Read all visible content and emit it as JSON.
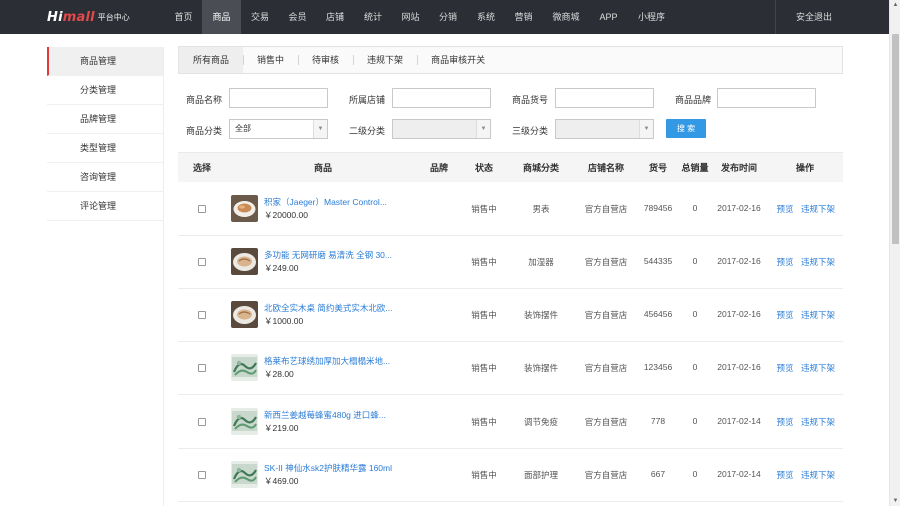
{
  "logo": {
    "brand_part1": "Hi",
    "brand_part2": "mall",
    "subtitle": "平台中心"
  },
  "nav": [
    "首页",
    "商品",
    "交易",
    "会员",
    "店铺",
    "统计",
    "网站",
    "分销",
    "系统",
    "营销",
    "微商城",
    "APP",
    "小程序"
  ],
  "nav_active": "商品",
  "logout": "安全退出",
  "sidebar": [
    {
      "label": "商品管理",
      "active": true
    },
    {
      "label": "分类管理",
      "active": false
    },
    {
      "label": "品牌管理",
      "active": false
    },
    {
      "label": "类型管理",
      "active": false
    },
    {
      "label": "咨询管理",
      "active": false
    },
    {
      "label": "评论管理",
      "active": false
    }
  ],
  "tabs": [
    {
      "label": "所有商品",
      "active": true
    },
    {
      "label": "销售中",
      "active": false
    },
    {
      "label": "待审核",
      "active": false
    },
    {
      "label": "违规下架",
      "active": false
    },
    {
      "label": "商品审核开关",
      "active": false
    }
  ],
  "filters": {
    "product_name_label": "商品名称",
    "store_label": "所属店铺",
    "sku_label": "商品货号",
    "brand_label": "商品品牌",
    "category_label": "商品分类",
    "category_value": "全部",
    "cat2_label": "二级分类",
    "cat3_label": "三级分类",
    "search_button": "搜 索"
  },
  "table": {
    "headers": [
      "选择",
      "商品",
      "品牌",
      "状态",
      "商城分类",
      "店铺名称",
      "货号",
      "总销量",
      "发布时间",
      "操作"
    ],
    "rows": [
      {
        "name": "积家（Jaeger）Master Control...",
        "price": "￥20000.00",
        "brand": "",
        "status": "销售中",
        "category": "男表",
        "store": "官方自营店",
        "sku": "789456",
        "sales": "0",
        "date": "2017-02-16",
        "action1": "预览",
        "action2": "违规下架",
        "img": "bowl"
      },
      {
        "name": "多功能 无网研磨 易清洗 全钢 30...",
        "price": "￥249.00",
        "brand": "",
        "status": "销售中",
        "category": "加湿器",
        "store": "官方自营店",
        "sku": "544335",
        "sales": "0",
        "date": "2017-02-16",
        "action1": "预览",
        "action2": "违规下架",
        "img": "plate"
      },
      {
        "name": "北欧全实木桌 简约美式实木北欧...",
        "price": "￥1000.00",
        "brand": "",
        "status": "销售中",
        "category": "装饰摆件",
        "store": "官方自营店",
        "sku": "456456",
        "sales": "0",
        "date": "2017-02-16",
        "action1": "预览",
        "action2": "违规下架",
        "img": "plate"
      },
      {
        "name": "格莱布艺球绣加厚加大榻榻米地...",
        "price": "￥28.00",
        "brand": "",
        "status": "销售中",
        "category": "装饰摆件",
        "store": "官方自营店",
        "sku": "123456",
        "sales": "0",
        "date": "2017-02-16",
        "action1": "预览",
        "action2": "违规下架",
        "img": "leaf"
      },
      {
        "name": "新西兰姜越莓蜂蜜480g 进口蜂...",
        "price": "￥219.00",
        "brand": "",
        "status": "销售中",
        "category": "调节免疫",
        "store": "官方自营店",
        "sku": "778",
        "sales": "0",
        "date": "2017-02-14",
        "action1": "预览",
        "action2": "违规下架",
        "img": "leaf"
      },
      {
        "name": "SK-II 神仙水sk2护肤精华露 160ml",
        "price": "￥469.00",
        "brand": "",
        "status": "销售中",
        "category": "面部护理",
        "store": "官方自营店",
        "sku": "667",
        "sales": "0",
        "date": "2017-02-14",
        "action1": "预览",
        "action2": "违规下架",
        "img": "leaf"
      }
    ]
  },
  "colors": {
    "topbar": "#2b2e35",
    "accent_red": "#e4393c",
    "link_blue": "#2b7cd6",
    "button_blue": "#3499e5"
  }
}
